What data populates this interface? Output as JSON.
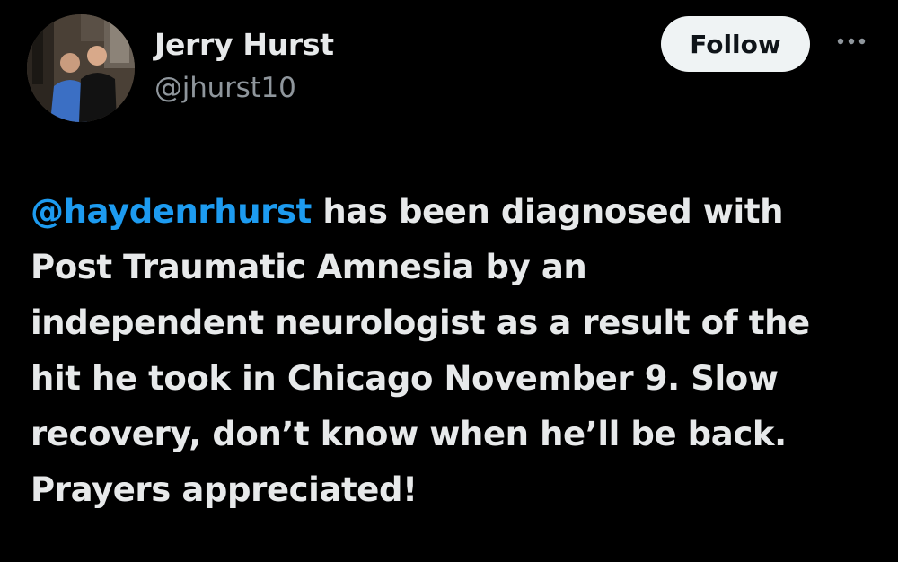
{
  "author": {
    "display_name": "Jerry Hurst",
    "handle": "@jhurst10",
    "avatar_icon": "profile-photo-two-men"
  },
  "actions": {
    "follow_label": "Follow",
    "more_icon": "more-horizontal-icon"
  },
  "tweet": {
    "mention": "@haydenrhurst",
    "lines": [
      " has been diagnosed with",
      "Post Traumatic Amnesia by an",
      "independent neurologist as a result of the",
      "hit he took in Chicago November 9.  Slow",
      "recovery, don’t know when he’ll be back.",
      "Prayers appreciated!"
    ]
  },
  "colors": {
    "background": "#000000",
    "text": "#e7e9ea",
    "secondary_text": "#8f969c",
    "mention": "#1d9bf0",
    "follow_bg": "#eff3f4"
  }
}
